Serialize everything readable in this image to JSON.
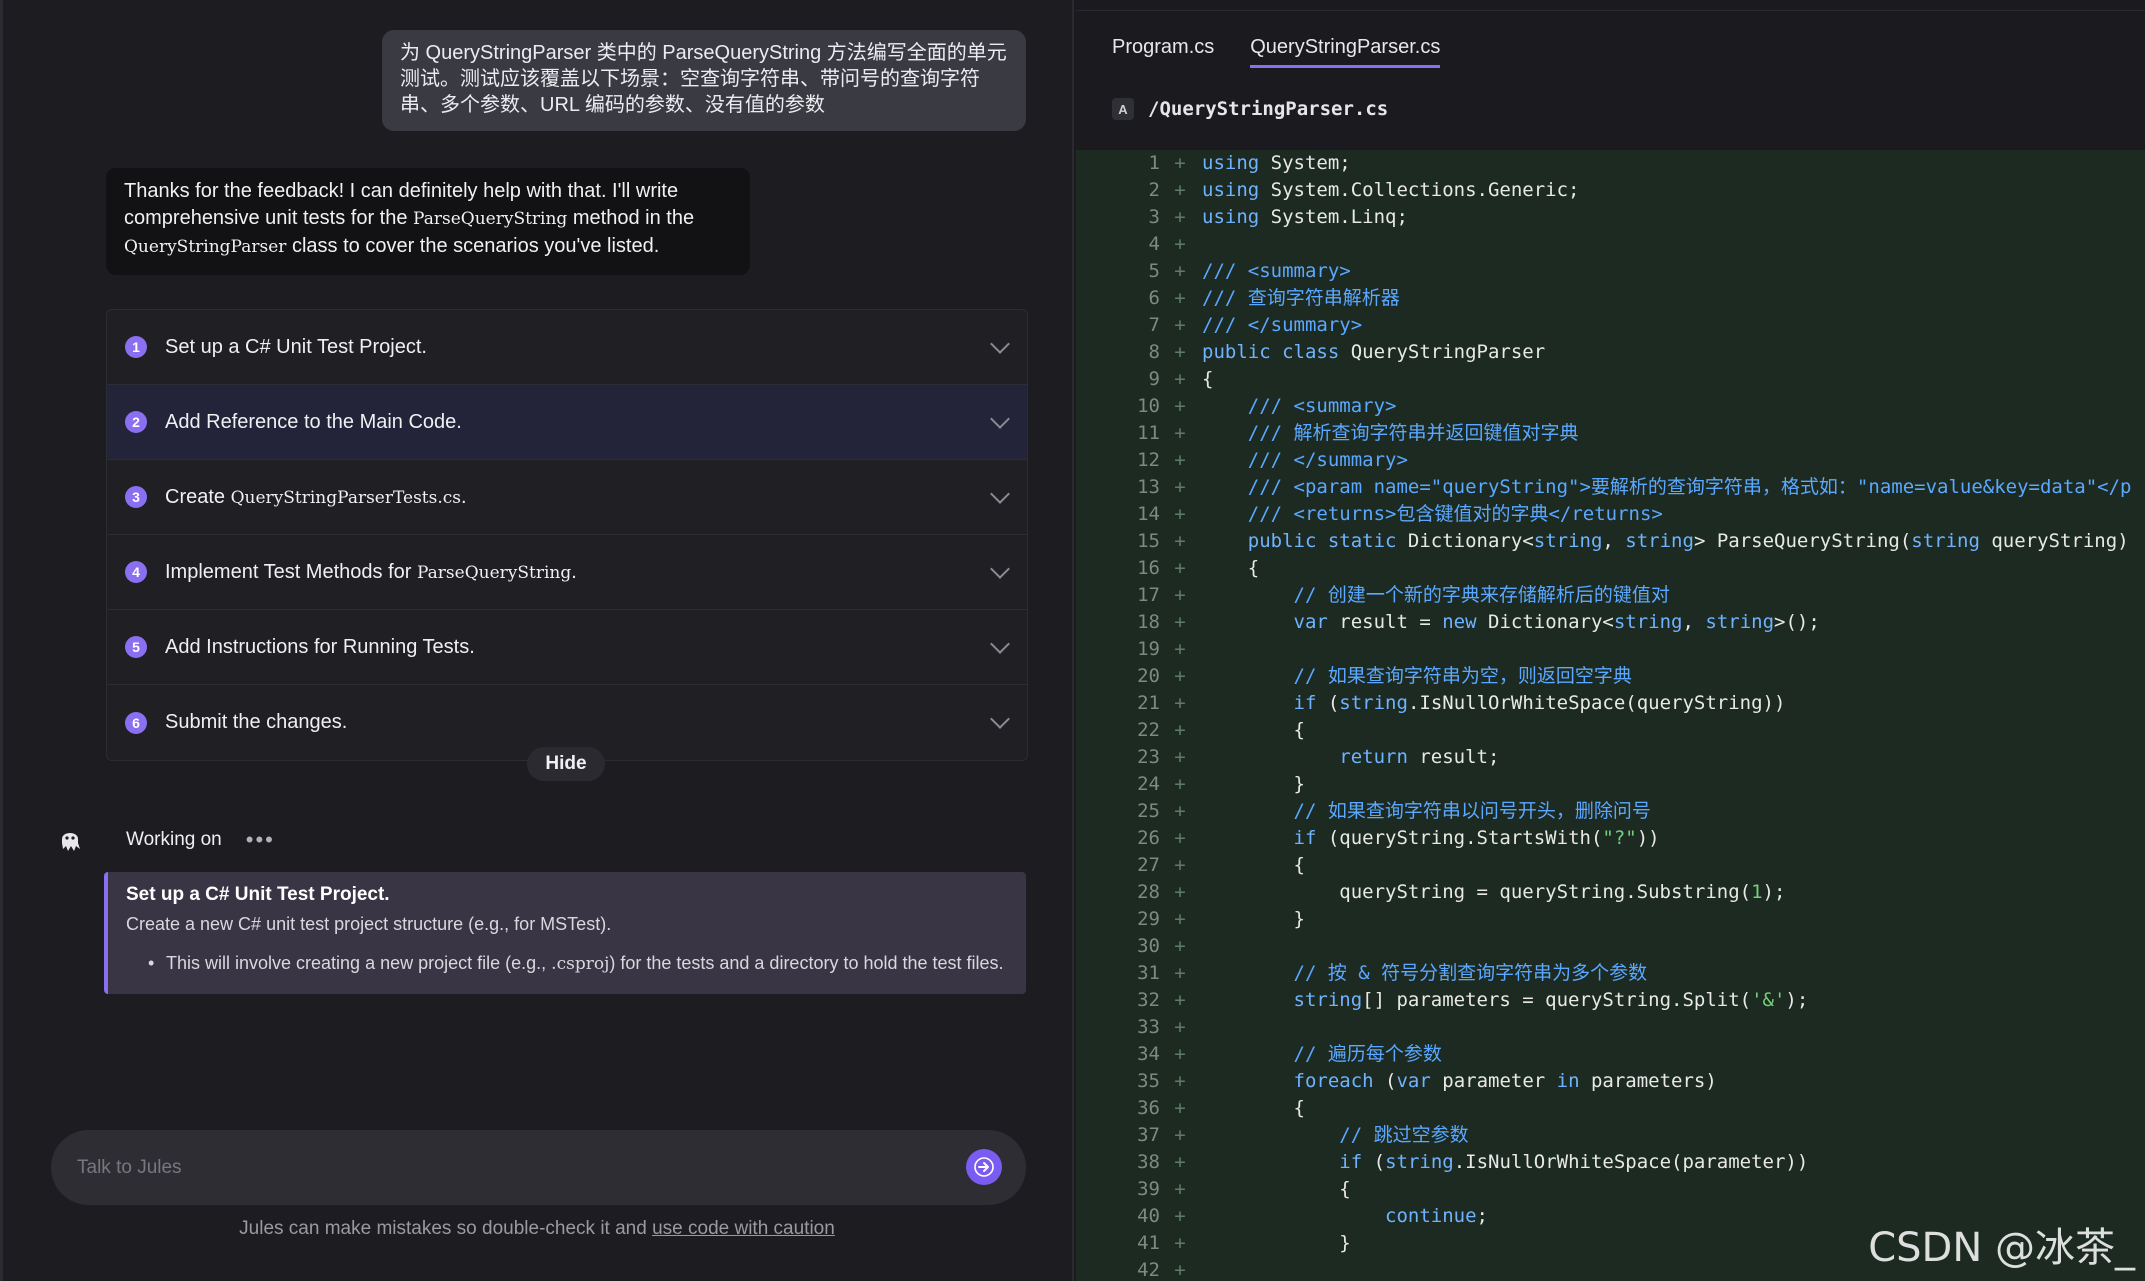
{
  "chat": {
    "user_message": "为 QueryStringParser 类中的 ParseQueryString 方法编写全面的单元测试。测试应该覆盖以下场景：空查询字符串、带问号的查询字符串、多个参数、URL 编码的参数、没有值的参数",
    "bot_message": {
      "part1": "Thanks for the feedback! I can definitely help with that. I'll write comprehensive unit tests for the ",
      "code1": "ParseQueryString",
      "part2": " method in the ",
      "code2": "QueryStringParser",
      "part3": " class to cover the scenarios you've listed."
    },
    "steps": [
      {
        "num": "1",
        "label": "Set up a C# Unit Test Project."
      },
      {
        "num": "2",
        "label": "Add Reference to the Main Code."
      },
      {
        "num": "3",
        "label": "Create ",
        "code": "QueryStringParserTests.cs",
        "suffix": "."
      },
      {
        "num": "4",
        "label": "Implement Test Methods for ",
        "code": "ParseQueryString",
        "suffix": "."
      },
      {
        "num": "5",
        "label": "Add Instructions for Running Tests."
      },
      {
        "num": "6",
        "label": "Submit the changes."
      }
    ],
    "hide_label": "Hide",
    "working_label": "Working on",
    "working_dots": "•••",
    "task": {
      "title": "Set up a C# Unit Test Project.",
      "desc": "Create a new C# unit test project structure (e.g., for MSTest).",
      "bullet_part1": "This will involve creating a new project file (e.g., ",
      "bullet_code": ".csproj",
      "bullet_part2": ") for the tests and a directory to hold the test files."
    },
    "input_placeholder": "Talk to Jules",
    "disclaimer_text": "Jules can make mistakes so double-check it and ",
    "disclaimer_link": "use code with caution"
  },
  "editor": {
    "tabs": [
      "Program.cs",
      "QueryStringParser.cs"
    ],
    "active_tab": "QueryStringParser.cs",
    "file_badge": "A",
    "file_path": "/QueryStringParser.cs",
    "lines": [
      {
        "n": "1",
        "html": "<span class='kw'>using</span> System;"
      },
      {
        "n": "2",
        "html": "<span class='kw'>using</span> System.Collections.Generic;"
      },
      {
        "n": "3",
        "html": "<span class='kw'>using</span> System.Linq;"
      },
      {
        "n": "4",
        "html": ""
      },
      {
        "n": "5",
        "html": "<span class='cm'>/// &lt;summary&gt;</span>"
      },
      {
        "n": "6",
        "html": "<span class='cm'>/// 查询字符串解析器</span>"
      },
      {
        "n": "7",
        "html": "<span class='cm'>/// &lt;/summary&gt;</span>"
      },
      {
        "n": "8",
        "html": "<span class='kw'>public class</span> QueryStringParser"
      },
      {
        "n": "9",
        "html": "{"
      },
      {
        "n": "10",
        "html": "    <span class='cm'>/// &lt;summary&gt;</span>"
      },
      {
        "n": "11",
        "html": "    <span class='cm'>/// 解析查询字符串并返回键值对字典</span>"
      },
      {
        "n": "12",
        "html": "    <span class='cm'>/// &lt;/summary&gt;</span>"
      },
      {
        "n": "13",
        "html": "    <span class='cm'>/// &lt;param name=\"queryString\"&gt;要解析的查询字符串，格式如：\"name=value&amp;key=data\"&lt;/p</span>"
      },
      {
        "n": "14",
        "html": "    <span class='cm'>/// &lt;returns&gt;包含键值对的字典&lt;/returns&gt;</span>"
      },
      {
        "n": "15",
        "html": "    <span class='kw'>public static</span> Dictionary&lt;<span class='kw'>string</span>, <span class='kw'>string</span>&gt; ParseQueryString(<span class='kw'>string</span> queryString)"
      },
      {
        "n": "16",
        "html": "    {"
      },
      {
        "n": "17",
        "html": "        <span class='cm'>// 创建一个新的字典来存储解析后的键值对</span>"
      },
      {
        "n": "18",
        "html": "        <span class='kw'>var</span> result = <span class='kw'>new</span> Dictionary&lt;<span class='kw'>string</span>, <span class='kw'>string</span>&gt;();"
      },
      {
        "n": "19",
        "html": ""
      },
      {
        "n": "20",
        "html": "        <span class='cm'>// 如果查询字符串为空，则返回空字典</span>"
      },
      {
        "n": "21",
        "html": "        <span class='kw'>if</span> (<span class='kw'>string</span>.IsNullOrWhiteSpace(queryString))"
      },
      {
        "n": "22",
        "html": "        {"
      },
      {
        "n": "23",
        "html": "            <span class='kw'>return</span> result;"
      },
      {
        "n": "24",
        "html": "        }"
      },
      {
        "n": "25",
        "html": "        <span class='cm'>// 如果查询字符串以问号开头，删除问号</span>"
      },
      {
        "n": "26",
        "html": "        <span class='kw'>if</span> (queryString.StartsWith(<span class='st'>\"?\"</span>))"
      },
      {
        "n": "27",
        "html": "        {"
      },
      {
        "n": "28",
        "html": "            queryString = queryString.Substring(<span class='st'>1</span>);"
      },
      {
        "n": "29",
        "html": "        }"
      },
      {
        "n": "30",
        "html": ""
      },
      {
        "n": "31",
        "html": "        <span class='cm'>// 按 &amp; 符号分割查询字符串为多个参数</span>"
      },
      {
        "n": "32",
        "html": "        <span class='kw'>string</span>[] parameters = queryString.Split(<span class='st'>'&amp;'</span>);"
      },
      {
        "n": "33",
        "html": ""
      },
      {
        "n": "34",
        "html": "        <span class='cm'>// 遍历每个参数</span>"
      },
      {
        "n": "35",
        "html": "        <span class='kw'>foreach</span> (<span class='kw'>var</span> parameter <span class='kw'>in</span> parameters)"
      },
      {
        "n": "36",
        "html": "        {"
      },
      {
        "n": "37",
        "html": "            <span class='cm'>// 跳过空参数</span>"
      },
      {
        "n": "38",
        "html": "            <span class='kw'>if</span> (<span class='kw'>string</span>.IsNullOrWhiteSpace(parameter))"
      },
      {
        "n": "39",
        "html": "            {"
      },
      {
        "n": "40",
        "html": "                <span class='kw'>continue</span>;"
      },
      {
        "n": "41",
        "html": "            }"
      },
      {
        "n": "42",
        "html": ""
      }
    ]
  },
  "watermark": "CSDN @冰茶_",
  "colors": {
    "accent": "#8a6ff0",
    "send": "#7b5cf0",
    "code_bg": "#1c2a22"
  }
}
